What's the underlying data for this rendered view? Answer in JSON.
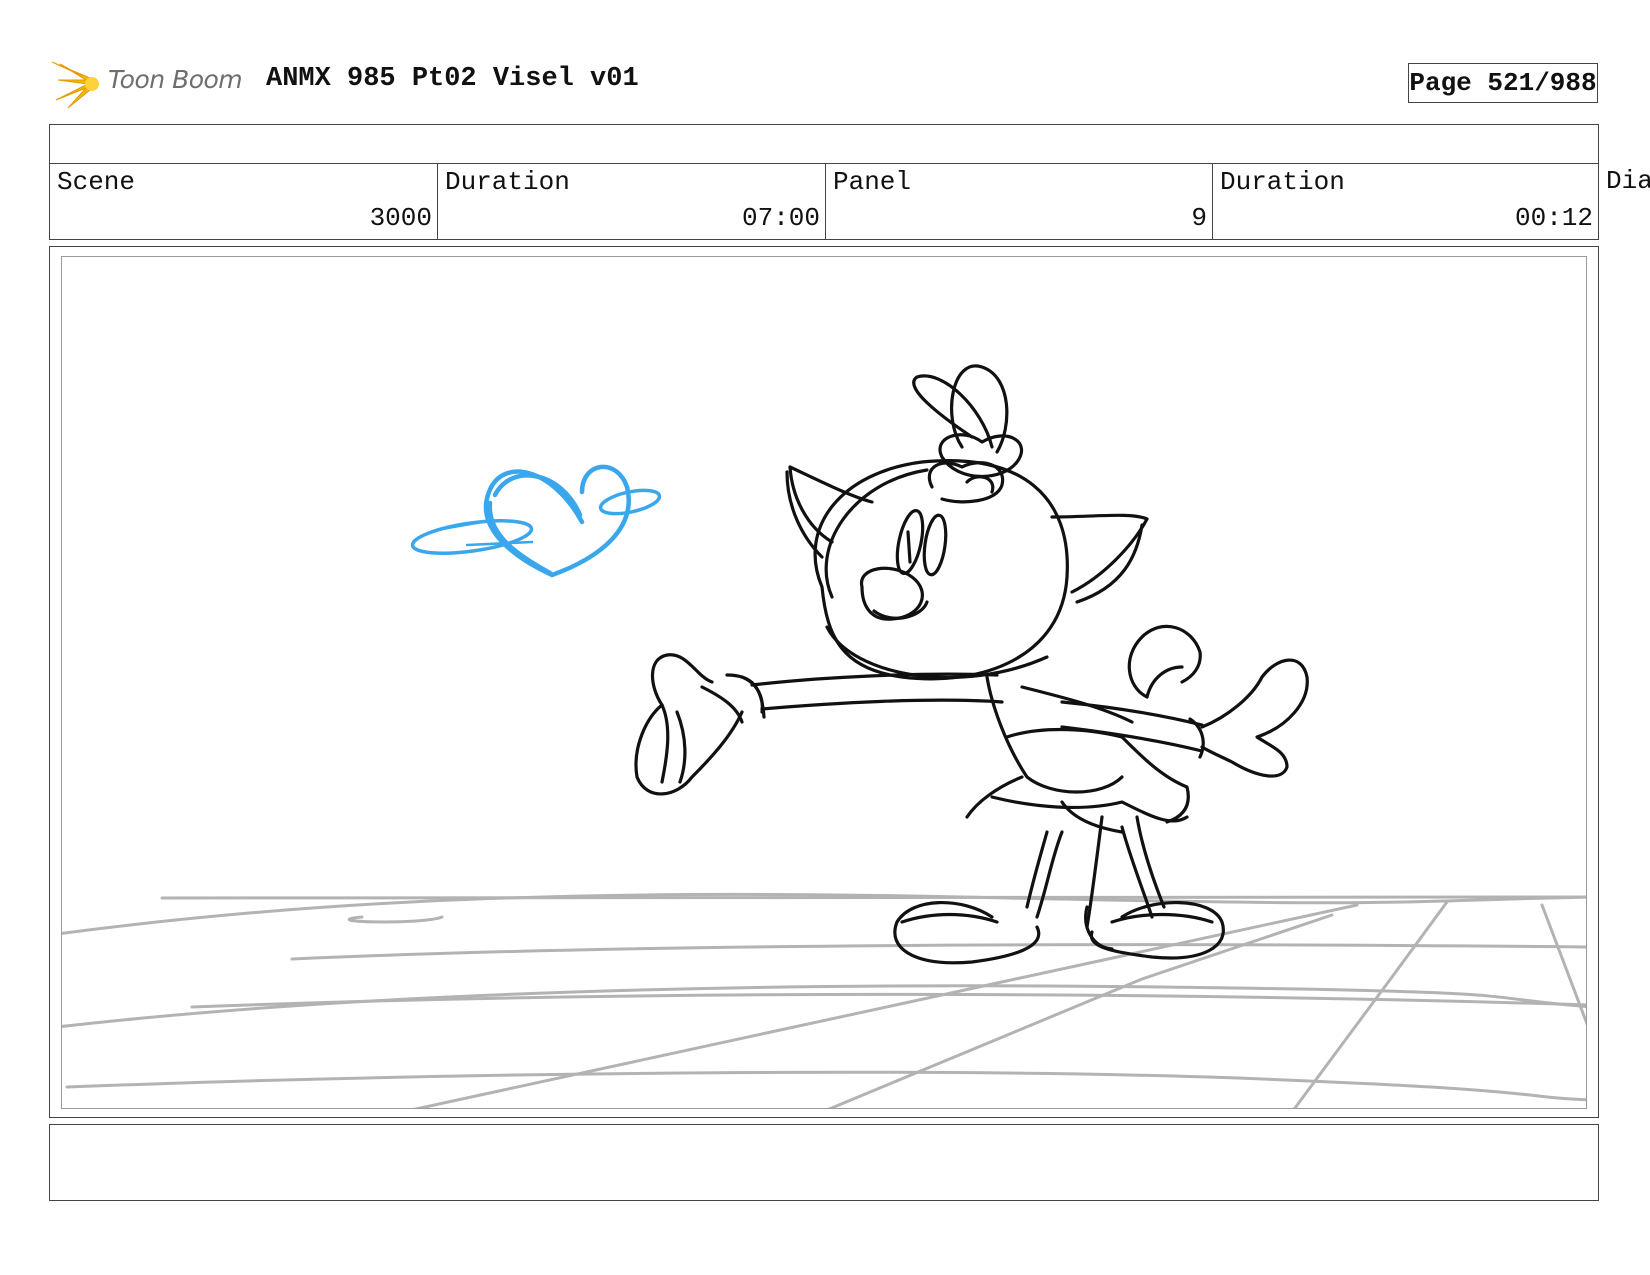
{
  "header": {
    "logo_text": "Toon Boom",
    "title": "ANMX 985 Pt02 Visel v01",
    "page_label": "Page 521/988"
  },
  "info": {
    "scene_label": "Scene",
    "scene_value": "3000",
    "scene_duration_label": "Duration",
    "scene_duration_value": "07:00",
    "panel_label": "Panel",
    "panel_value": "9",
    "panel_duration_label": "Duration",
    "panel_duration_value": "00:12",
    "dialogue_label": "Dia"
  },
  "colors": {
    "logo_star": "#f5b800",
    "sketch_line": "#111111",
    "blue_sketch": "#3aa7ec",
    "floor_grid": "#b3b3b3"
  }
}
